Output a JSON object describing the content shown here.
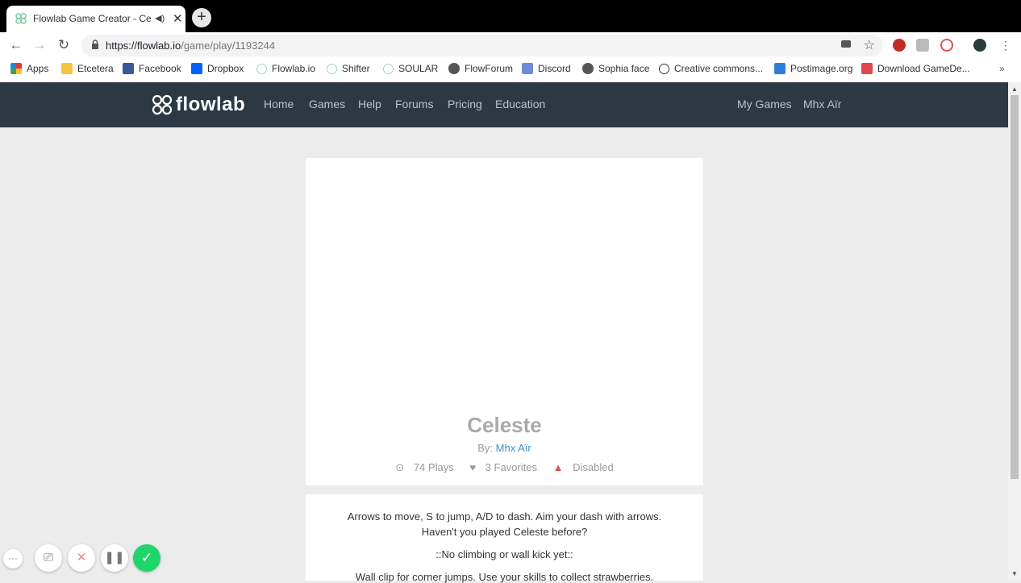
{
  "browser": {
    "tab_title": "Flowlab Game Creator - Cele",
    "url_host": "https://flowlab.io",
    "url_path": "/game/play/1193244",
    "bookmarks": [
      "Apps",
      "Etcetera",
      "Facebook",
      "Dropbox",
      "Flowlab.io",
      "Shifter",
      "SOULAR",
      "FlowForum",
      "Discord",
      "Sophia face",
      "Creative commons...",
      "Postimage.org",
      "Download GameDe..."
    ],
    "more_label": "»"
  },
  "site": {
    "logo_text": "flowlab",
    "nav": [
      "Home",
      "Games",
      "Help",
      "Forums",
      "Pricing",
      "Education"
    ],
    "nav_right": [
      "My Games",
      "Mhx Aïr"
    ]
  },
  "game": {
    "title": "Celeste",
    "by_label": "By:",
    "author": "Mhx Aïr",
    "plays": "74 Plays",
    "favorites": "3 Favorites",
    "status": "Disabled"
  },
  "description": {
    "line1": "Arrows to move, S to jump, A/D to dash. Aim your dash with arrows.",
    "line2": "Haven't you played Celeste before?",
    "line3": "::No climbing or wall kick yet::",
    "line4": "Wall clip for corner jumps. Use your skills to collect strawberries."
  },
  "icons": {
    "back": "arrow-left-icon",
    "forward": "arrow-right-icon",
    "reload": "reload-icon",
    "lock": "lock-icon",
    "star": "star-icon",
    "play": "play-circle-icon",
    "heart": "heart-icon",
    "warning": "warning-icon"
  },
  "colors": {
    "nav_bg": "#2c3945",
    "link": "#3f8fd2",
    "warn": "#d9534f",
    "confirm": "#1fd66b"
  }
}
